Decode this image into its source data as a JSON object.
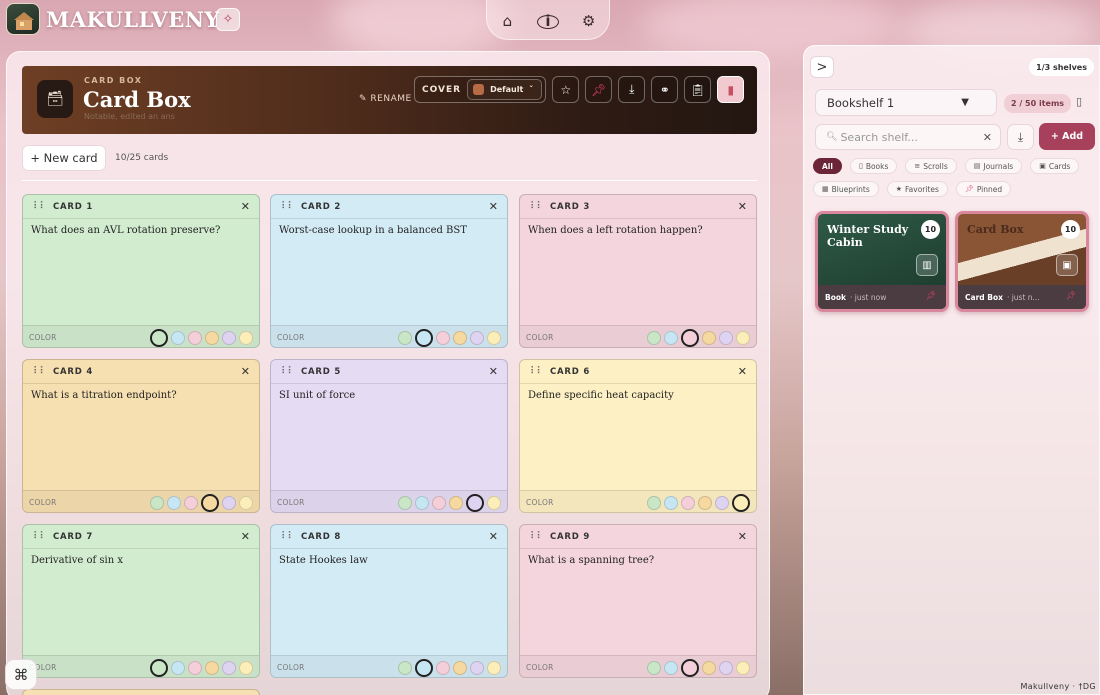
{
  "app": {
    "title": "MAKULLVENY"
  },
  "nav": {
    "home_icon": "home-icon",
    "info_icon": "info-icon",
    "settings_icon": "gear-icon"
  },
  "box": {
    "kicker": "CARD BOX",
    "title": "Card Box",
    "subtitle": "Notable, edited an ans",
    "rename_label": "RENAME"
  },
  "toolbar": {
    "cover_label": "COVER",
    "cover_value": "Default",
    "cover_color": "#b86a44"
  },
  "cards_area": {
    "new_card_label": "+ New card",
    "card_count": "10/25 cards",
    "color_label": "COLOR"
  },
  "cards": [
    {
      "label": "CARD 1",
      "question": "What does an AVL rotation preserve?",
      "color": "green",
      "selected": 0
    },
    {
      "label": "CARD 2",
      "question": "Worst-case lookup in a balanced BST",
      "color": "blue",
      "selected": 1
    },
    {
      "label": "CARD 3",
      "question": "When does a left rotation happen?",
      "color": "pink",
      "selected": 2
    },
    {
      "label": "CARD 4",
      "question": "What is a titration endpoint?",
      "color": "orange",
      "selected": 3
    },
    {
      "label": "CARD 5",
      "question": "SI unit of force",
      "color": "purple",
      "selected": 4
    },
    {
      "label": "CARD 6",
      "question": "Define specific heat capacity",
      "color": "yellow",
      "selected": 5
    },
    {
      "label": "CARD 7",
      "question": "Derivative of sin x",
      "color": "green",
      "selected": 0
    },
    {
      "label": "CARD 8",
      "question": "State Hookes law",
      "color": "blue",
      "selected": 1
    },
    {
      "label": "CARD 9",
      "question": "What is a spanning tree?",
      "color": "pink",
      "selected": 2
    }
  ],
  "colors": {
    "green": "#d2ecd0",
    "blue": "#d3ebf5",
    "pink": "#f4d5de",
    "orange": "#f6dfb0",
    "purple": "#e5dcf4",
    "yellow": "#fdf0c4",
    "accent": "#a7405b"
  },
  "sidebar": {
    "shelf_count": "1/3 shelves",
    "shelf_name": "Bookshelf 1",
    "items_badge": "2 / 50 items",
    "search_placeholder": "Search shelf...",
    "add_label": "+ Add",
    "filters": [
      "All",
      "Books",
      "Scrolls",
      "Journals",
      "Cards",
      "Blueprints",
      "Favorites",
      "Pinned"
    ],
    "active_filter": "All",
    "tiles": [
      {
        "title": "Winter Study Cabin",
        "count": "10",
        "type": "Book",
        "time": "· just now",
        "icon": "book-icon"
      },
      {
        "title": "Card Box",
        "count": "10",
        "type": "Card Box",
        "time": "· just n...",
        "icon": "card-box-icon"
      }
    ]
  },
  "footer": {
    "credit": "Makullveny · †DG"
  }
}
